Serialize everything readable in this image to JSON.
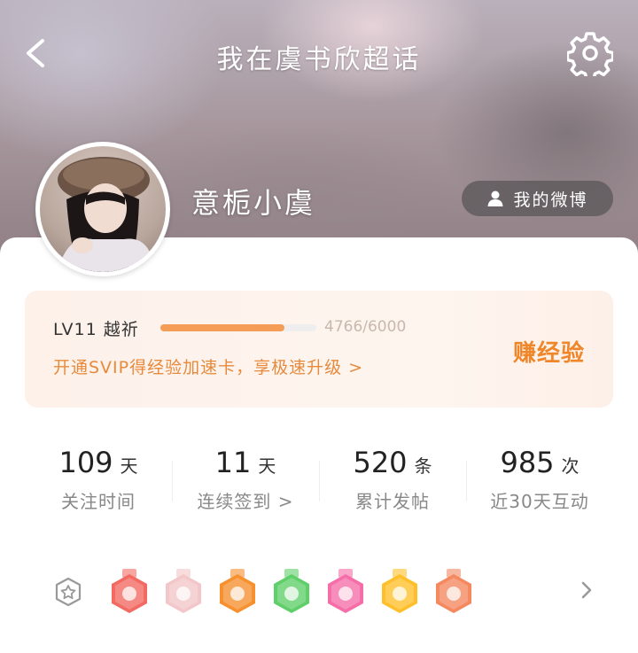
{
  "header": {
    "title": "我在虞书欣超话"
  },
  "user": {
    "name": "意栀小虞",
    "my_weibo_label": "我的微博"
  },
  "level": {
    "name": "LV11 越祈",
    "current": 4766,
    "max": 6000,
    "progress_text": "4766/6000",
    "promo_text": "开通SVIP得经验加速卡，享极速升级 >",
    "earn_label": "赚经验"
  },
  "stats": [
    {
      "value": "109",
      "unit": "天",
      "label": "关注时间"
    },
    {
      "value": "11",
      "unit": "天",
      "label": "连续签到 >"
    },
    {
      "value": "520",
      "unit": "条",
      "label": "累计发帖"
    },
    {
      "value": "985",
      "unit": "次",
      "label": "近30天互动"
    }
  ],
  "badges": [
    {
      "icon": "trophy-badge-icon",
      "color": "#f26a62"
    },
    {
      "icon": "avatar-sticker-badge-icon",
      "color": "#f3c7c9"
    },
    {
      "icon": "orange-hexagon-badge-icon",
      "color": "#f7902f"
    },
    {
      "icon": "hand-badge-icon",
      "color": "#5fcf69"
    },
    {
      "icon": "graduation-cap-badge-icon",
      "color": "#f56ea8"
    },
    {
      "icon": "smiley-badge-icon",
      "color": "#ffbf2a"
    },
    {
      "icon": "heart-hand-badge-icon",
      "color": "#f4885f"
    }
  ],
  "colors": {
    "accent": "#f59d56",
    "promo": "#e78a3c"
  }
}
